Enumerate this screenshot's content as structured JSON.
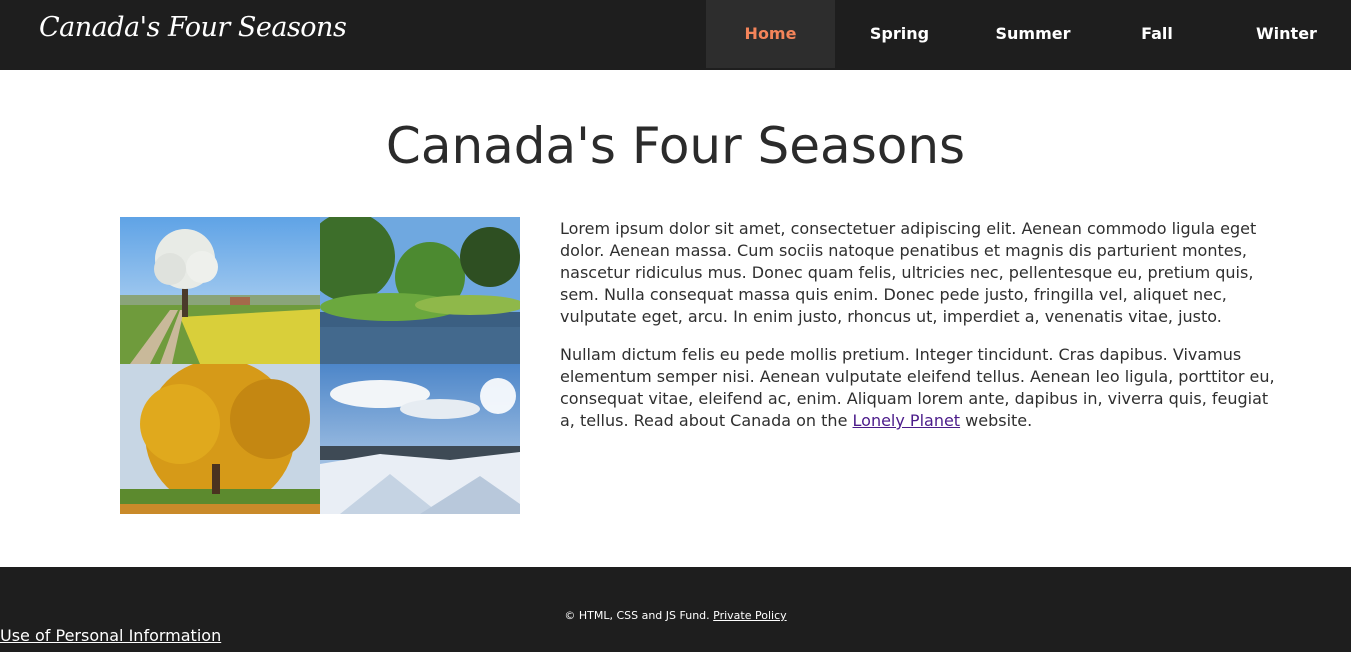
{
  "header": {
    "brand": "Canada's Four Seasons",
    "nav": [
      {
        "label": "Home",
        "active": true
      },
      {
        "label": "Spring"
      },
      {
        "label": "Summer"
      },
      {
        "label": "Fall"
      },
      {
        "label": "Winter"
      }
    ]
  },
  "main": {
    "title": "Canada's Four Seasons",
    "paragraph1": "Lorem ipsum dolor sit amet, consectetuer adipiscing elit. Aenean commodo ligula eget dolor. Aenean massa. Cum sociis natoque penatibus et magnis dis parturient montes, nascetur ridiculus mus. Donec quam felis, ultricies nec, pellentesque eu, pretium quis, sem. Nulla consequat massa quis enim. Donec pede justo, fringilla vel, aliquet nec, vulputate eget, arcu. In enim justo, rhoncus ut, imperdiet a, venenatis vitae, justo.",
    "paragraph2_text": "Nullam dictum felis eu pede mollis pretium. Integer tincidunt. Cras dapibus. Vivamus elementum semper nisi. Aenean vulputate eleifend tellus. Aenean leo ligula, porttitor eu, consequat vitae, eleifend ac, enim. Aliquam lorem ante, dapibus in, viverra quis, feugiat a, tellus. Read about Canada on the",
    "paragraph2_link": "Lonely Planet",
    "paragraph2_end": " website."
  },
  "footer": {
    "copyright": "© HTML, CSS and JS Fund.",
    "policy_link": "Private Policy",
    "personal_info_link": "Use of Personal Information"
  },
  "colors": {
    "header_bg": "#1e1e1e",
    "active_nav": "#f4845a",
    "link": "#4b1b8a"
  }
}
